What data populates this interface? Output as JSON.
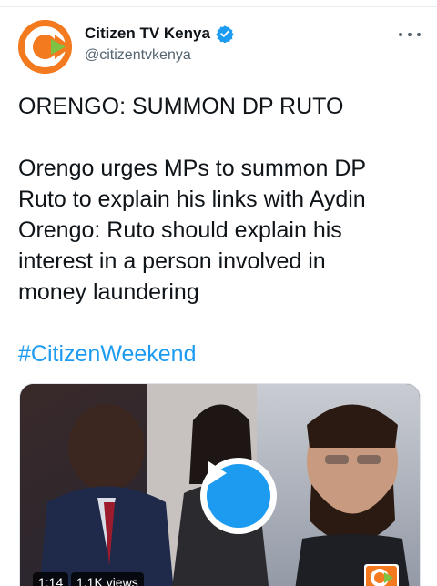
{
  "account": {
    "display_name": "Citizen TV Kenya",
    "handle": "@citizentvkenya",
    "verified": true,
    "avatar_icon": "citizen-tv-logo",
    "brand_color": "#f47a20"
  },
  "tweet": {
    "headline": "ORENGO: SUMMON DP RUTO",
    "body_lines": [
      "Orengo urges MPs to summon DP",
      "Ruto to explain his links with Aydin",
      "Orengo: Ruto should explain his",
      "interest in a person involved in",
      "money laundering"
    ],
    "hashtag": "#CitizenWeekend"
  },
  "video": {
    "duration": "1:14",
    "views": "1.1K views",
    "play_icon": "play-icon",
    "accent_color": "#1d9bf0"
  }
}
